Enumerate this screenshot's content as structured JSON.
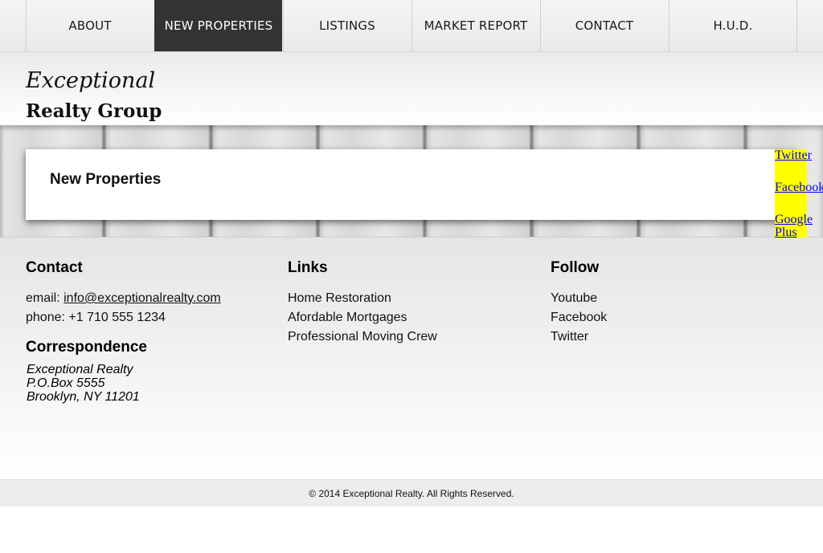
{
  "nav": {
    "items": [
      {
        "label": "ABOUT"
      },
      {
        "label": "NEW PROPERTIES",
        "active": true
      },
      {
        "label": "LISTINGS"
      },
      {
        "label": "MARKET REPORT"
      },
      {
        "label": "CONTACT"
      },
      {
        "label": "H.U.D."
      }
    ]
  },
  "header": {
    "logo_line1": "Exceptional",
    "logo_line2": "Realty Group"
  },
  "main": {
    "title": "New Properties"
  },
  "social": {
    "twitter": "Twitter",
    "facebook": "Facebook",
    "google_plus_1": "Google",
    "google_plus_2": "Plus",
    "highlight_color": "#ffff00",
    "link_color": "#0000ee"
  },
  "footer": {
    "contact": {
      "heading": "Contact",
      "email_label": "email: ",
      "email": "info@exceptionalrealty.com",
      "phone": "phone: +1 710 555 1234"
    },
    "correspondence": {
      "heading": "Correspondence",
      "lines": [
        "Exceptional Realty",
        "P.O.Box 5555",
        "Brooklyn, NY 11201"
      ]
    },
    "links": {
      "heading": "Links",
      "items": [
        "Home Restoration",
        "Afordable Mortgages",
        "Professional Moving Crew"
      ]
    },
    "follow": {
      "heading": "Follow",
      "items": [
        "Youtube",
        "Facebook",
        "Twitter"
      ]
    },
    "copyright": "© 2014 Exceptional Realty. All Rights Reserved."
  },
  "colors": {
    "nav_active_bg": "#333333",
    "nav_active_text": "#ffffff"
  }
}
